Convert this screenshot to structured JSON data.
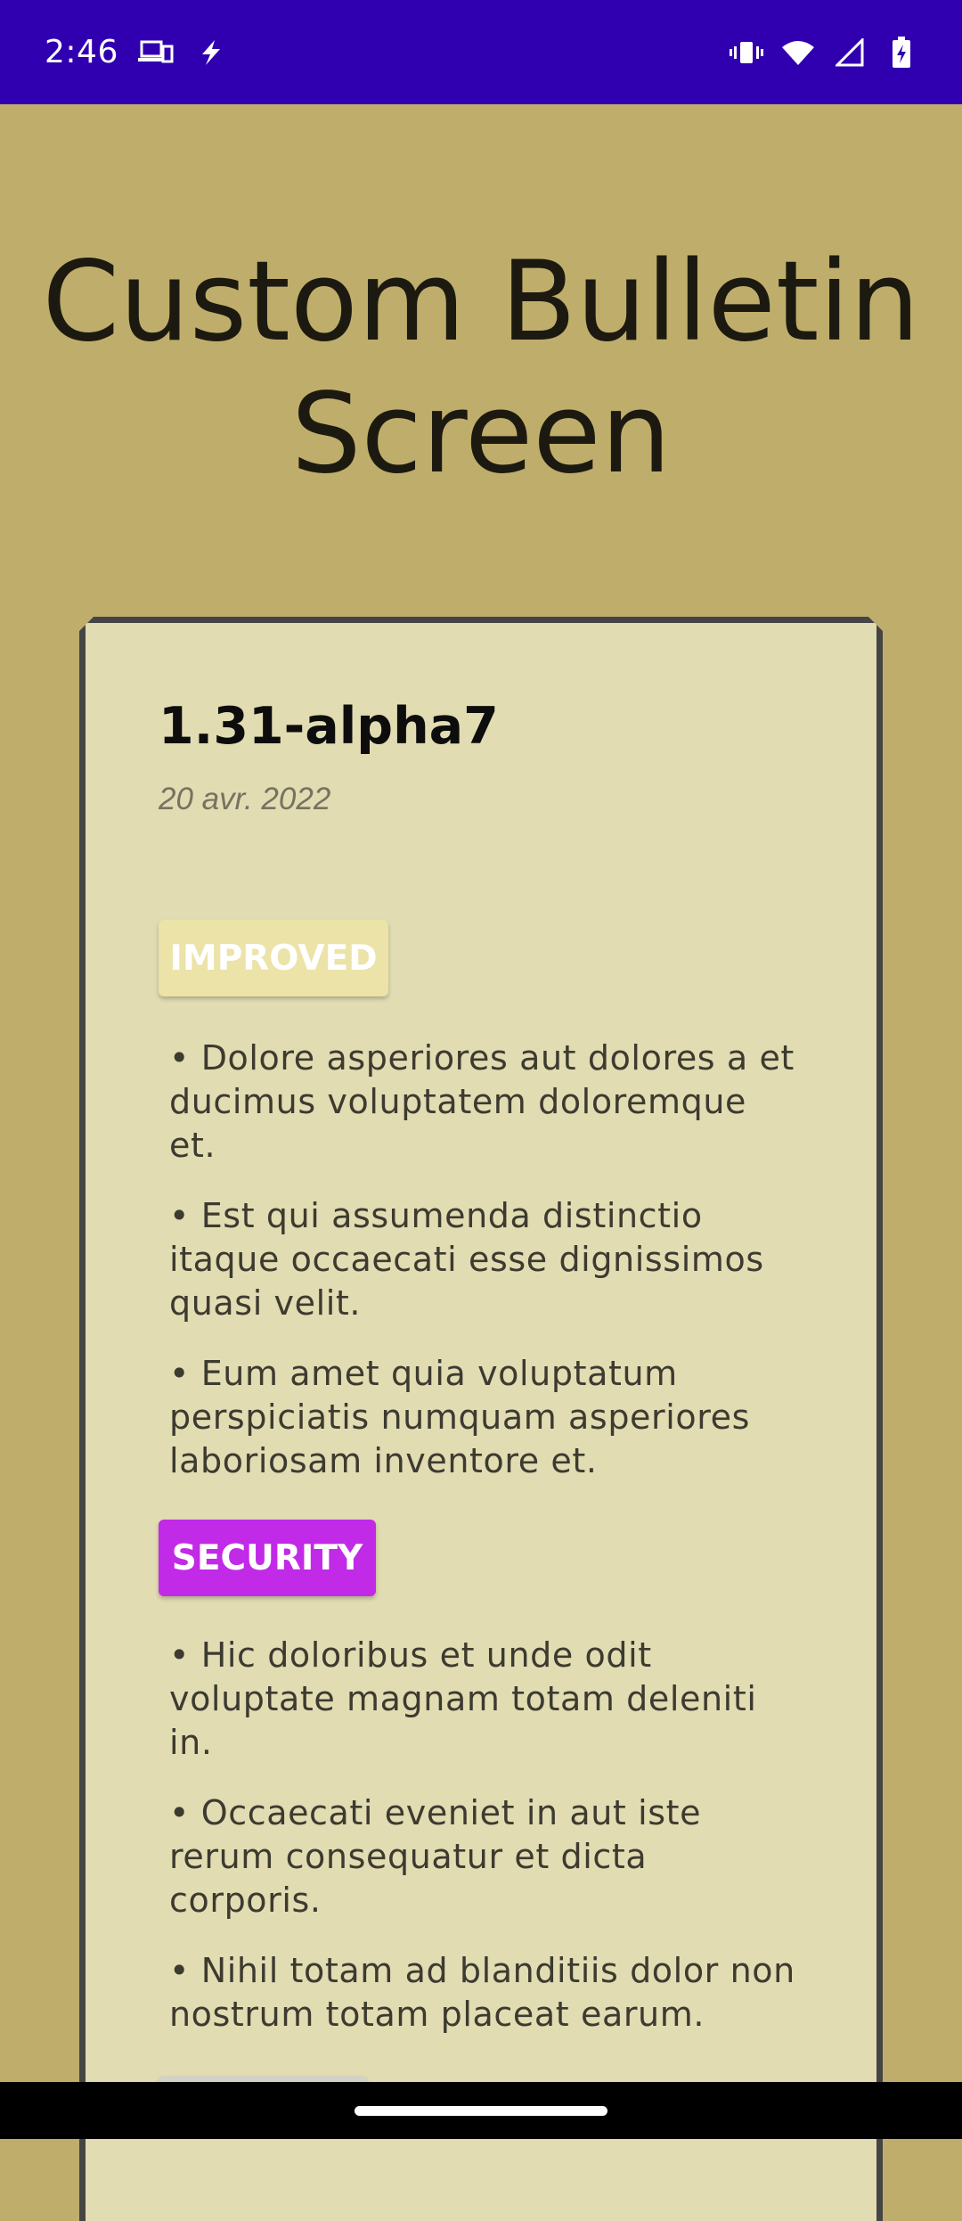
{
  "status_bar": {
    "time": "2:46",
    "left_icons": [
      "devices-icon",
      "flash-icon"
    ],
    "right_icons": [
      "vibrate-icon",
      "wifi-icon",
      "signal-icon",
      "battery-charging-icon"
    ],
    "background": "#3000b0"
  },
  "screen": {
    "title": "Custom Bulletin Screen",
    "background": "#bfae6b"
  },
  "bulletin": {
    "version": "1.31-alpha7",
    "date": "20 avr. 2022",
    "card_background": "#e1dcb2",
    "sections": [
      {
        "badge": "IMPROVED",
        "badge_color": "#ebe3a8",
        "items": [
          "• Dolore asperiores aut dolores a et ducimus voluptatem doloremque et.",
          "• Est qui assumenda distinctio itaque occaecati esse dignissimos quasi velit.",
          "• Eum amet quia voluptatum perspiciatis numquam asperiores laboriosam inventore et."
        ]
      },
      {
        "badge": "SECURITY",
        "badge_color": "#c12ae6",
        "items": [
          "• Hic doloribus et unde odit voluptate magnam totam deleniti in.",
          "• Occaecati eveniet in aut iste rerum consequatur et dicta corporis.",
          "• Nihil totam ad blanditiis dolor non nostrum totam placeat earum."
        ]
      },
      {
        "badge": "",
        "badge_color": "#d4d2c6",
        "items": []
      }
    ]
  }
}
